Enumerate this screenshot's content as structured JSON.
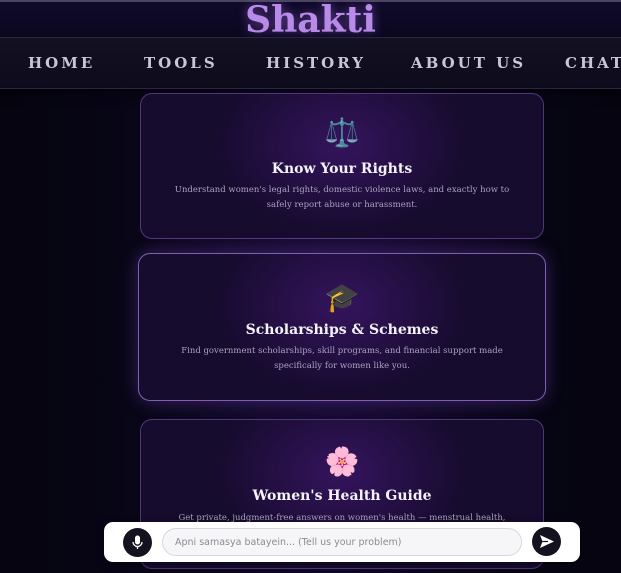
{
  "app": {
    "brand": "Shakti"
  },
  "nav": {
    "items": [
      {
        "label": "HOME"
      },
      {
        "label": "TOOLS"
      },
      {
        "label": "HISTORY"
      },
      {
        "label": "ABOUT US"
      },
      {
        "label": "CHATI"
      }
    ]
  },
  "cards": [
    {
      "icon": "⚖️",
      "icon_name": "scales-icon",
      "title": "Know Your Rights",
      "description": "Understand women's legal rights, domestic violence laws, and exactly how to safely report abuse or harassment."
    },
    {
      "icon": "🎓",
      "icon_name": "graduation-cap-icon",
      "title": "Scholarships & Schemes",
      "description": "Find government scholarships, skill programs, and financial support made specifically for women like you."
    },
    {
      "icon": "🌸",
      "icon_name": "cherry-blossom-icon",
      "title": "Women's Health Guide",
      "description": "Get private, judgment-free answers on women's health — menstrual health, nutrition, pregnancy,"
    }
  ],
  "chat": {
    "placeholder": "Apni samasya batayein... (Tell us your problem)",
    "mic_icon": "microphone-icon",
    "send_icon": "send-icon"
  },
  "colors": {
    "brand": "#b98be8",
    "background": "#07051a",
    "card_border": "#9a6ed2"
  }
}
